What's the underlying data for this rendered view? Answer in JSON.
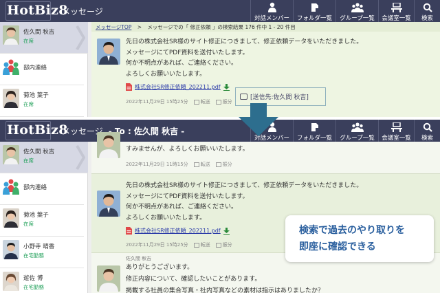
{
  "app": {
    "logo": "HotBiz8",
    "module": "メッセージ",
    "conversation_title": "- To : 佐久間 秋吉 -"
  },
  "nav": [
    {
      "label": "対話メンバー",
      "icon": "person-icon"
    },
    {
      "label": "フォルダ一覧",
      "icon": "folder-icon"
    },
    {
      "label": "グループ一覧",
      "icon": "group-icon"
    },
    {
      "label": "会議室一覧",
      "icon": "meeting-room-icon"
    },
    {
      "label": "検索",
      "icon": "search-icon"
    }
  ],
  "contacts_top": [
    {
      "name": "佐久間 秋吉",
      "status": "在席",
      "active": true
    },
    {
      "name": "部内連絡",
      "status": "",
      "group": true
    },
    {
      "name": "菊池 葉子",
      "status": "在席"
    }
  ],
  "contacts_bottom": [
    {
      "name": "佐久間 秋吉",
      "status": "在席",
      "active": true
    },
    {
      "name": "部内連絡",
      "status": "",
      "group": true
    },
    {
      "name": "菊池 葉子",
      "status": "在席"
    },
    {
      "name": "小野寺 晴香",
      "status": "在宅勤務"
    },
    {
      "name": "遊佐 博",
      "status": "在宅勤務"
    }
  ],
  "breadcrumb": {
    "root": "メッセージTOP",
    "separator": ">",
    "text": "メッセージでの「 修正依頼 」の検索結果 176 件中 1 - 20 件目"
  },
  "search_result": {
    "lines": [
      "先日の株式会社SR様のサイト修正につきまして、修正依頼データをいただきました。",
      "メッセージにてPDF資料を送付いたします。",
      "何か不明点があれば、ご連絡ください。",
      "よろしくお願いいたします。"
    ],
    "file": "株式会社SR修正依頼_202211.pdf",
    "timestamp": "2022年11月29日 15時25分",
    "forward": "転送",
    "tag": "振分",
    "sent_to": "[送信先:佐久間 秋吉]"
  },
  "thread": {
    "prev_partial": "すみませんが、よろしくお願いいたします。",
    "prev_timestamp": "2022年11月29日 11時15分",
    "highlight": {
      "lines": [
        "先日の株式会社SR様のサイト修正につきまして、修正依頼データをいただきました。",
        "メッセージにてPDF資料を送付いたします。",
        "何か不明点があれば、ご連絡ください。",
        "よろしくお願いいたします。"
      ],
      "file": "株式会社SR修正依頼_202211.pdf",
      "timestamp": "2022年11月29日 15時25分"
    },
    "reply": {
      "sender": "佐久間 秋吉",
      "lines": [
        "ありがとうございます。",
        "修正内容について、確認したいことがあります。",
        "掲載する社員の集合写真・社内写真などの素材は指示はありましたか？"
      ]
    },
    "forward": "転送",
    "tag": "振分"
  },
  "callout": {
    "line1": "検索で過去のやり取りを",
    "line2": "即座に確認できる"
  },
  "colors": {
    "header": "#3a3f5c",
    "content_bg": "#eef5e2",
    "arrow": "#2d6e8e",
    "callout_text": "#2a5f9e",
    "status_green": "#21a05a"
  }
}
